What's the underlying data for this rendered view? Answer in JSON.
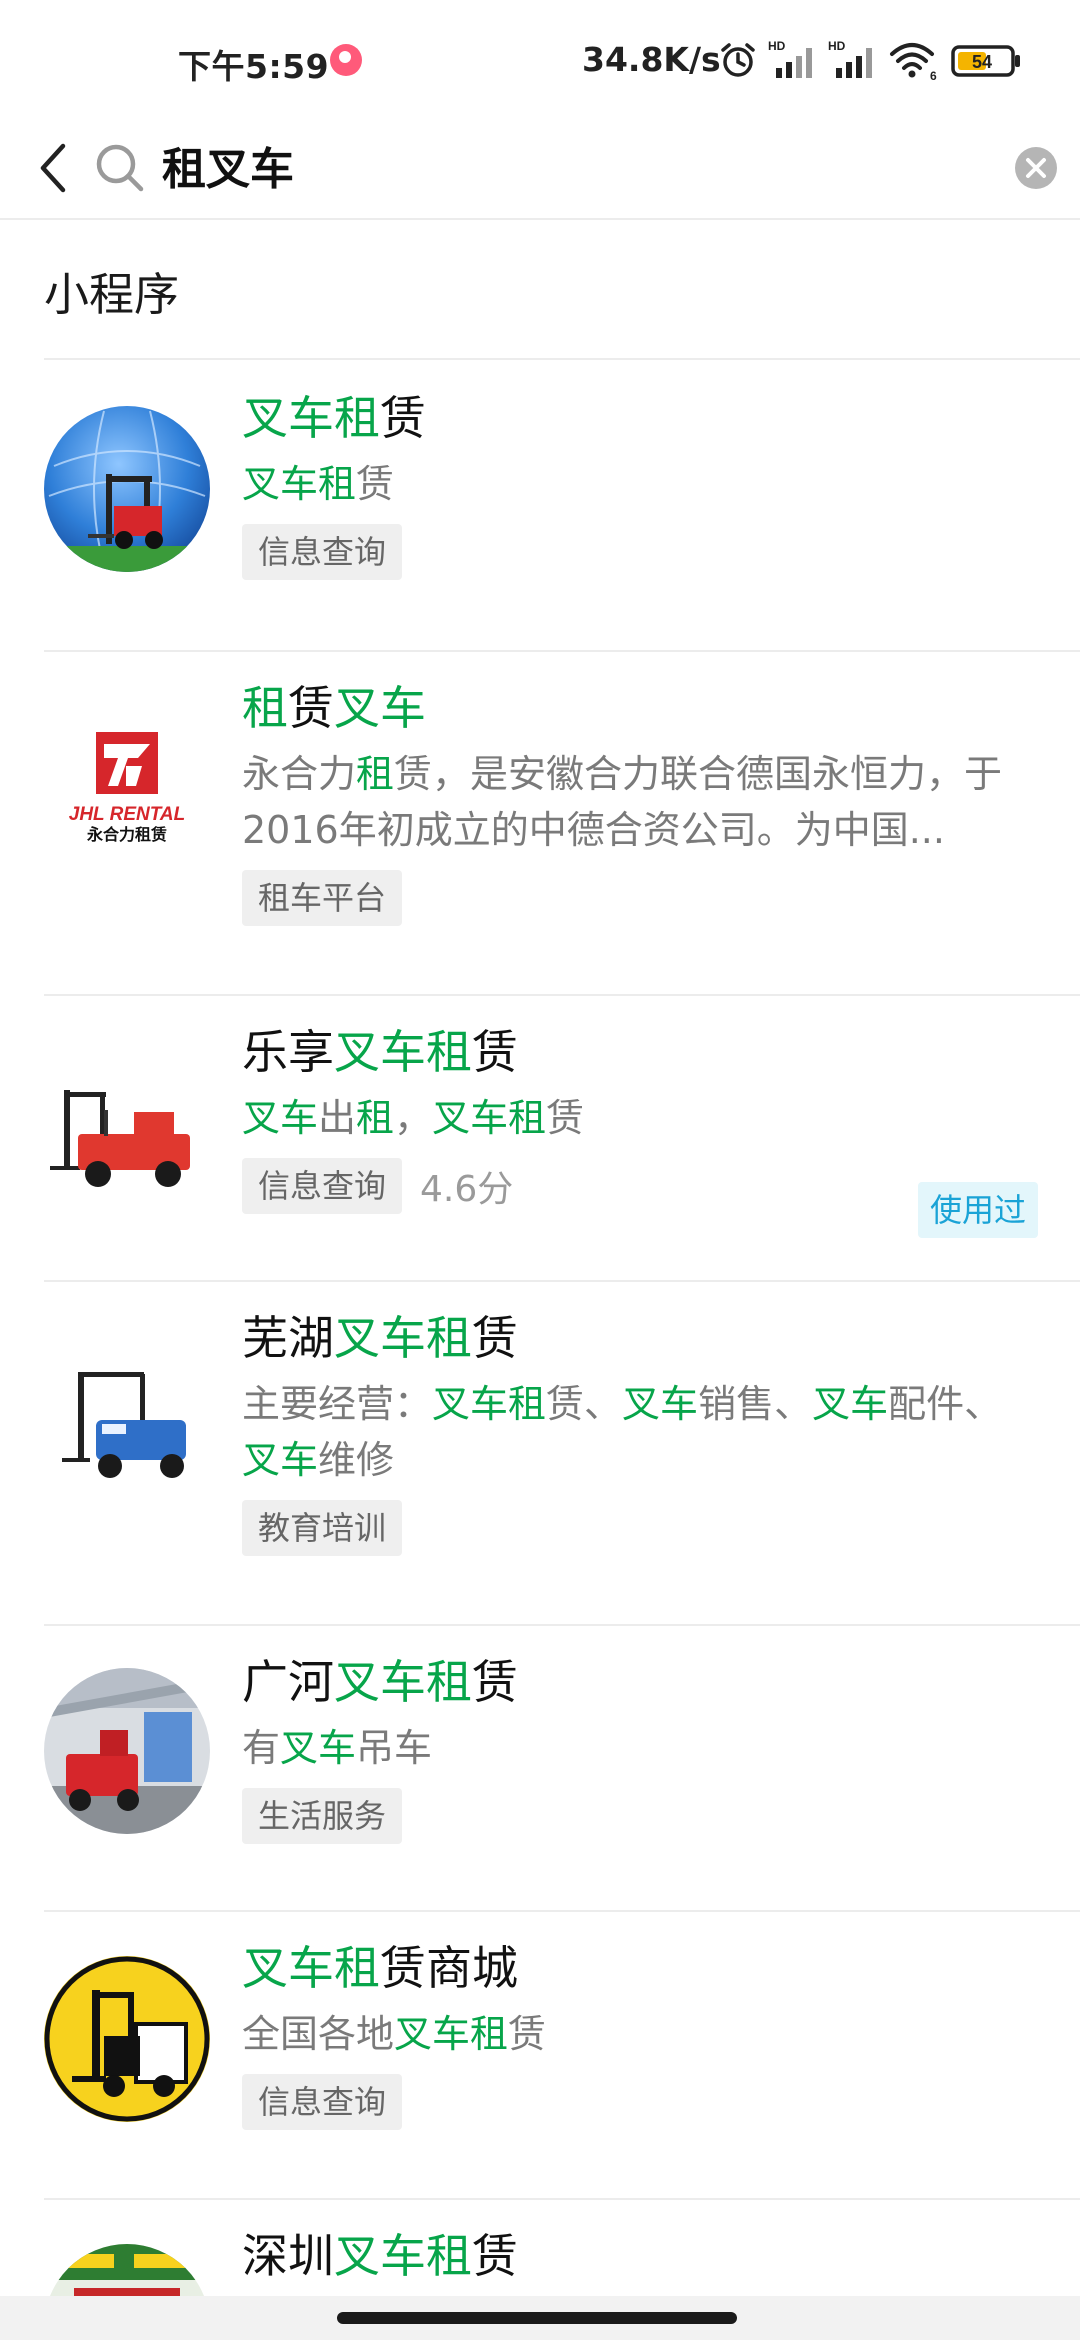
{
  "status_bar": {
    "time": "下午5:59",
    "network_speed": "34.8K/s",
    "battery": "54",
    "signal_label_1": "HD",
    "signal_label_2": "HD",
    "wifi_label": "6"
  },
  "search": {
    "query": "租叉车"
  },
  "section": {
    "title": "小程序"
  },
  "results": [
    {
      "title": [
        {
          "t": "叉车租",
          "h": true
        },
        {
          "t": "赁",
          "h": false
        }
      ],
      "desc": [
        {
          "t": "叉车租",
          "h": true
        },
        {
          "t": "赁",
          "h": false
        }
      ],
      "tag": "信息查询",
      "rating": "",
      "used": ""
    },
    {
      "title": [
        {
          "t": "租",
          "h": true
        },
        {
          "t": "赁",
          "h": false
        },
        {
          "t": "叉车",
          "h": true
        }
      ],
      "desc": [
        {
          "t": "永合力",
          "h": false
        },
        {
          "t": "租",
          "h": true
        },
        {
          "t": "赁，是安徽合力联合德国永恒力，于2016年初成立的中德合资公司。为中国...",
          "h": false
        }
      ],
      "tag": "租车平台",
      "rating": "",
      "used": ""
    },
    {
      "title": [
        {
          "t": "乐享",
          "h": false
        },
        {
          "t": "叉车租",
          "h": true
        },
        {
          "t": "赁",
          "h": false
        }
      ],
      "desc": [
        {
          "t": "叉车",
          "h": true
        },
        {
          "t": "出",
          "h": false
        },
        {
          "t": "租",
          "h": true
        },
        {
          "t": "，",
          "h": false
        },
        {
          "t": "叉车租",
          "h": true
        },
        {
          "t": "赁",
          "h": false
        }
      ],
      "tag": "信息查询",
      "rating": "4.6分",
      "used": "使用过"
    },
    {
      "title": [
        {
          "t": "芜湖",
          "h": false
        },
        {
          "t": "叉车租",
          "h": true
        },
        {
          "t": "赁",
          "h": false
        }
      ],
      "desc": [
        {
          "t": "主要经营：",
          "h": false
        },
        {
          "t": "叉车租",
          "h": true
        },
        {
          "t": "赁、",
          "h": false
        },
        {
          "t": "叉车",
          "h": true
        },
        {
          "t": "销售、",
          "h": false
        },
        {
          "t": "叉车",
          "h": true
        },
        {
          "t": "配件、",
          "h": false
        },
        {
          "t": "叉车",
          "h": true
        },
        {
          "t": "维修",
          "h": false
        }
      ],
      "tag": "教育培训",
      "rating": "",
      "used": ""
    },
    {
      "title": [
        {
          "t": "广河",
          "h": false
        },
        {
          "t": "叉车租",
          "h": true
        },
        {
          "t": "赁",
          "h": false
        }
      ],
      "desc": [
        {
          "t": "有",
          "h": false
        },
        {
          "t": "叉车",
          "h": true
        },
        {
          "t": "吊车",
          "h": false
        }
      ],
      "tag": "生活服务",
      "rating": "",
      "used": ""
    },
    {
      "title": [
        {
          "t": "叉车租",
          "h": true
        },
        {
          "t": "赁商城",
          "h": false
        }
      ],
      "desc": [
        {
          "t": "全国各地",
          "h": false
        },
        {
          "t": "叉车租",
          "h": true
        },
        {
          "t": "赁",
          "h": false
        }
      ],
      "tag": "信息查询",
      "rating": "",
      "used": ""
    },
    {
      "title": [
        {
          "t": "深圳",
          "h": false
        },
        {
          "t": "叉车租",
          "h": true
        },
        {
          "t": "赁",
          "h": false
        }
      ],
      "desc": [],
      "tag": "",
      "rating": "",
      "used": ""
    }
  ],
  "logos": {
    "jhl_brand": "JHL RENTAL",
    "jhl_cn": "永合力租赁"
  },
  "colors": {
    "highlight": "#07a54a",
    "used_badge": "#1aa3d6"
  }
}
